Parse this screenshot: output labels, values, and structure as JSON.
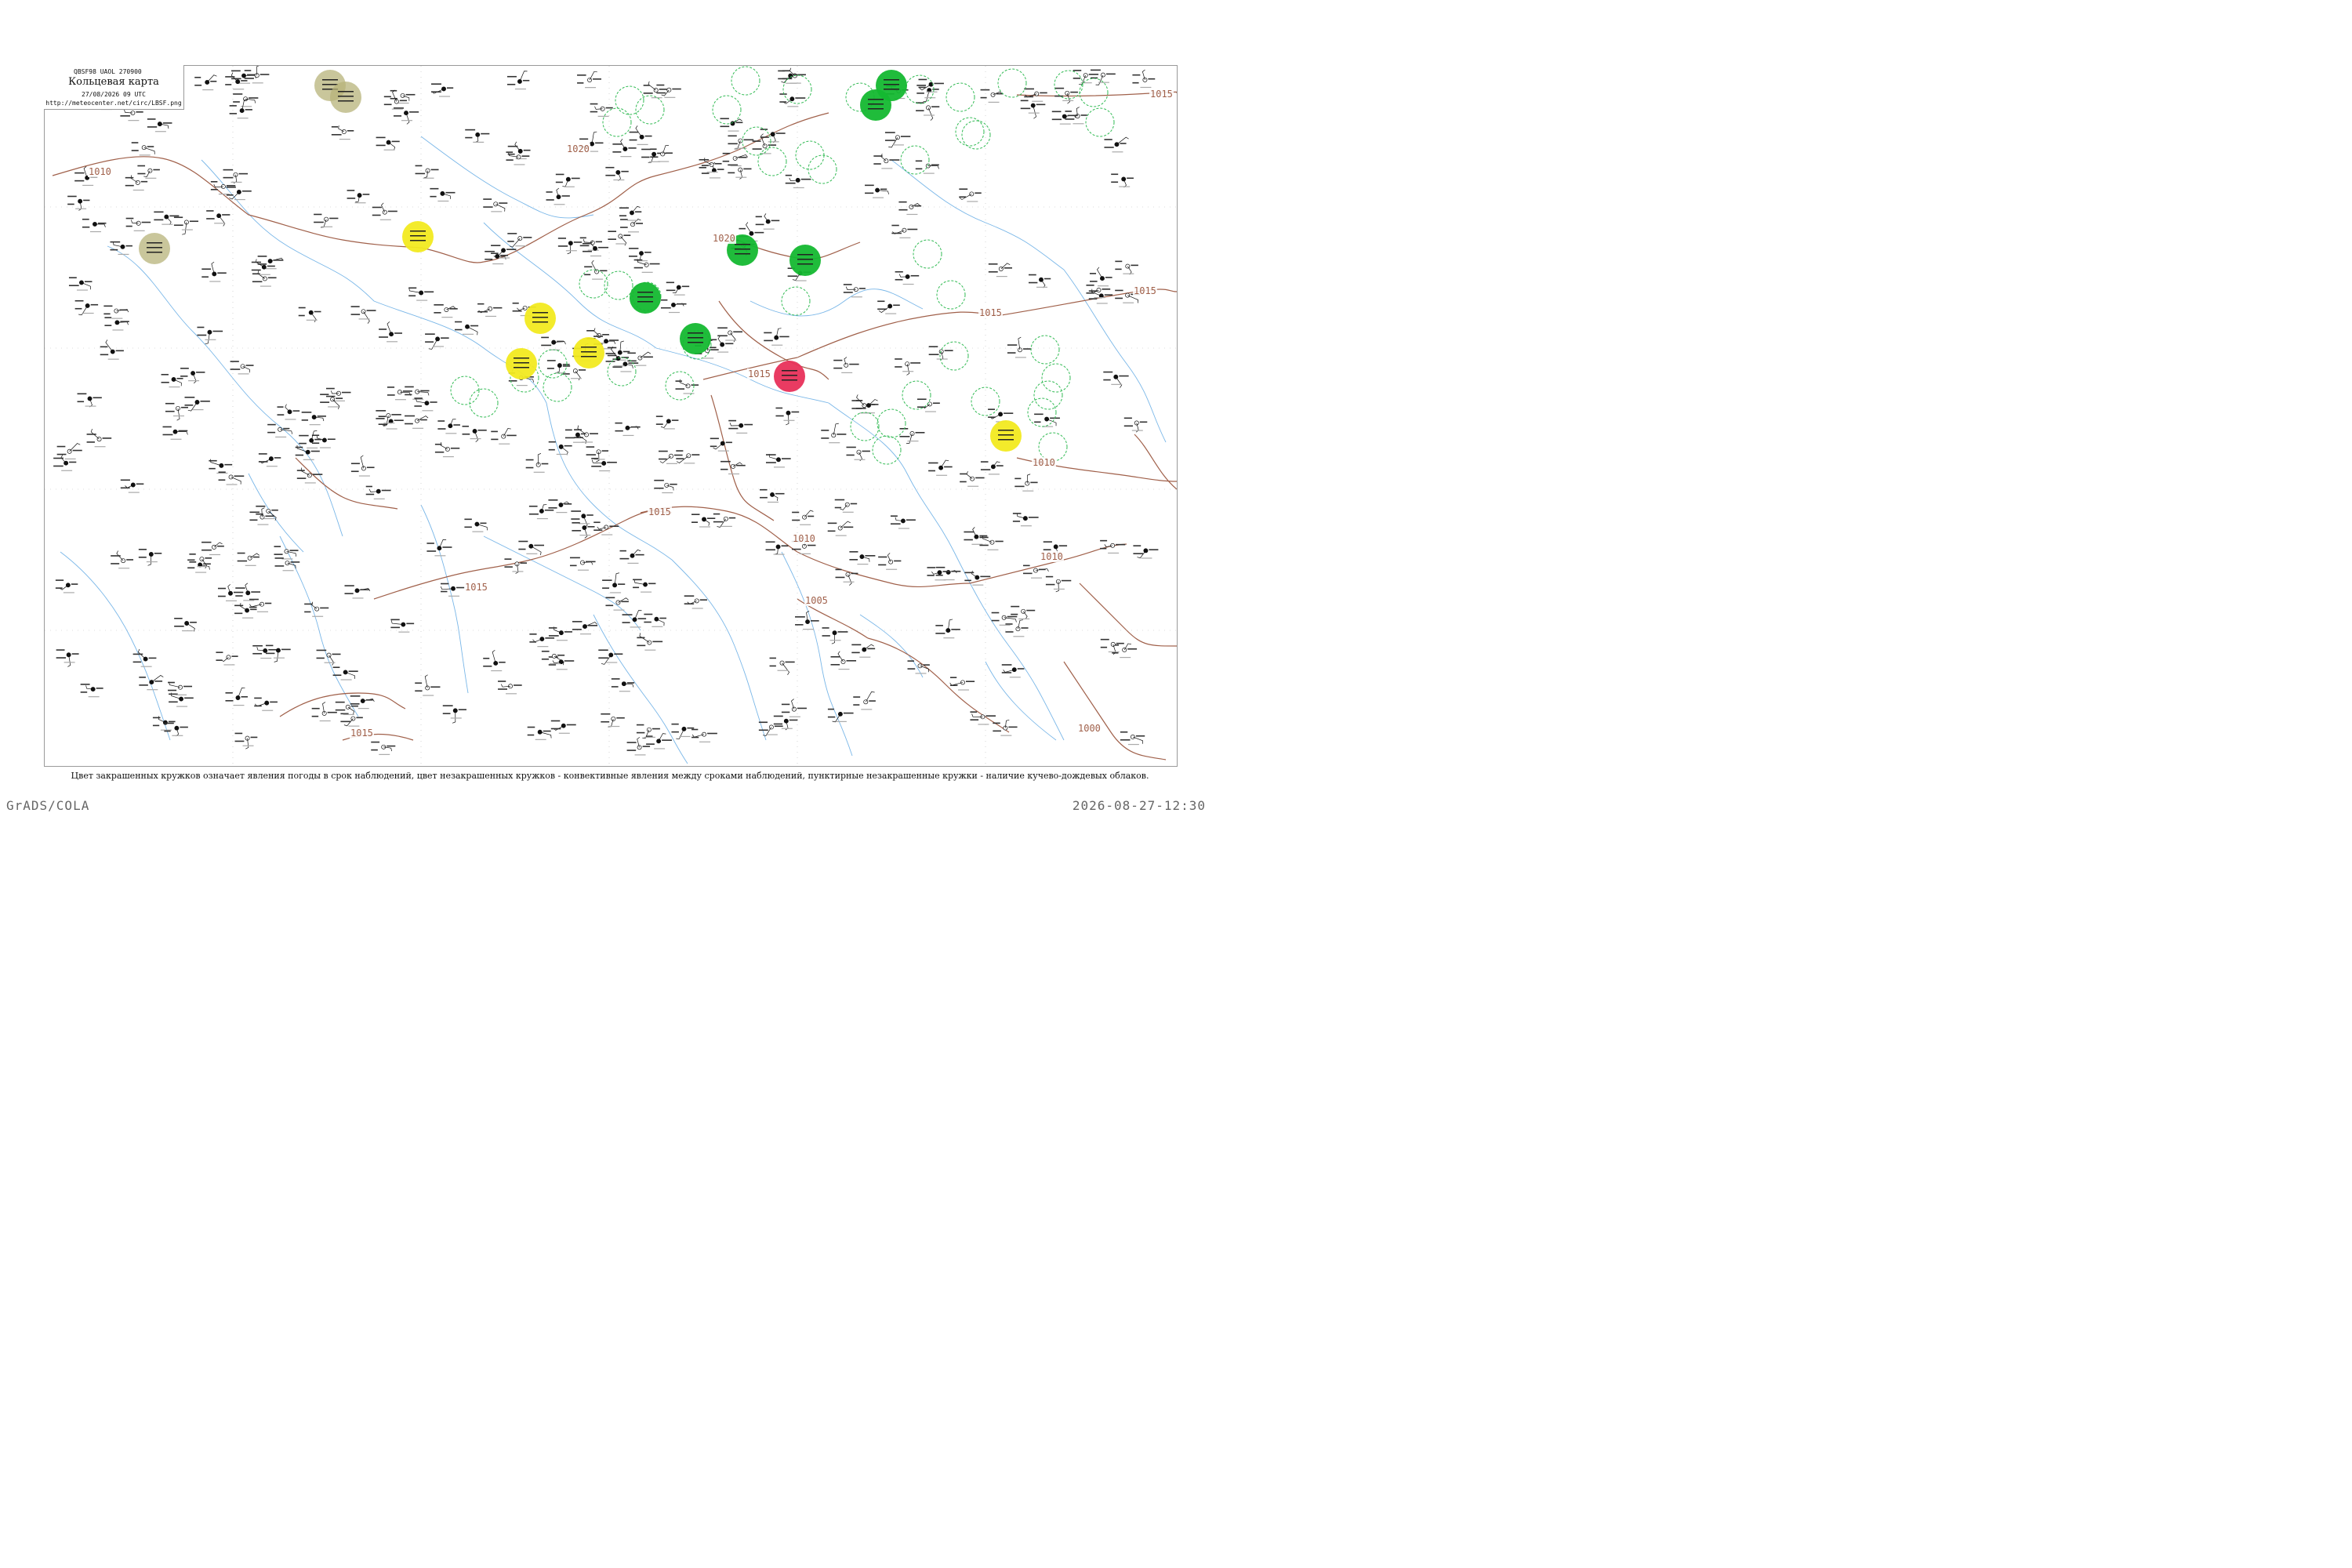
{
  "header": {
    "code": "QBSF98  UAOL  270900",
    "title": "Кольцевая карта",
    "datetime": "27/08/2026 09 UTC",
    "url": "http://meteocenter.net/circ/LBSF.png"
  },
  "isobar_labels": [
    {
      "id": "iso-1015-ne",
      "text": "1015"
    },
    {
      "id": "iso-1010-w",
      "text": "1010"
    },
    {
      "id": "iso-1020-n",
      "text": "1020"
    },
    {
      "id": "iso-1020-c",
      "text": "1020"
    },
    {
      "id": "iso-1015-c",
      "text": "1015"
    },
    {
      "id": "iso-1015-e",
      "text": "1015"
    },
    {
      "id": "iso-1015-e2",
      "text": "1015"
    },
    {
      "id": "iso-1015-s1",
      "text": "1015"
    },
    {
      "id": "iso-1015-s2",
      "text": "1015"
    },
    {
      "id": "iso-1010-se",
      "text": "1010"
    },
    {
      "id": "iso-1005-s",
      "text": "1005"
    },
    {
      "id": "iso-1010-s",
      "text": "1010"
    },
    {
      "id": "iso-1015-sw",
      "text": "1015"
    },
    {
      "id": "iso-1000-se",
      "text": "1000"
    },
    {
      "id": "iso-1010-e",
      "text": "1010"
    }
  ],
  "legend": {
    "colors": {
      "green": "#14b830",
      "yellow": "#f2ea20",
      "red": "#e8305a",
      "olive": "#b7b37a",
      "dashed": "#33bb55"
    }
  },
  "caption": "Цвет закрашенных кружков означает явления погоды в срок наблюдений, цвет незакрашенных кружков - конвективные явления между сроками наблюдений, пунктирные незакрашенные кружки - наличие кучево-дождевых облаков.",
  "footer": {
    "left": "GrADS/COLA",
    "right": "2026-08-27-12:30"
  }
}
